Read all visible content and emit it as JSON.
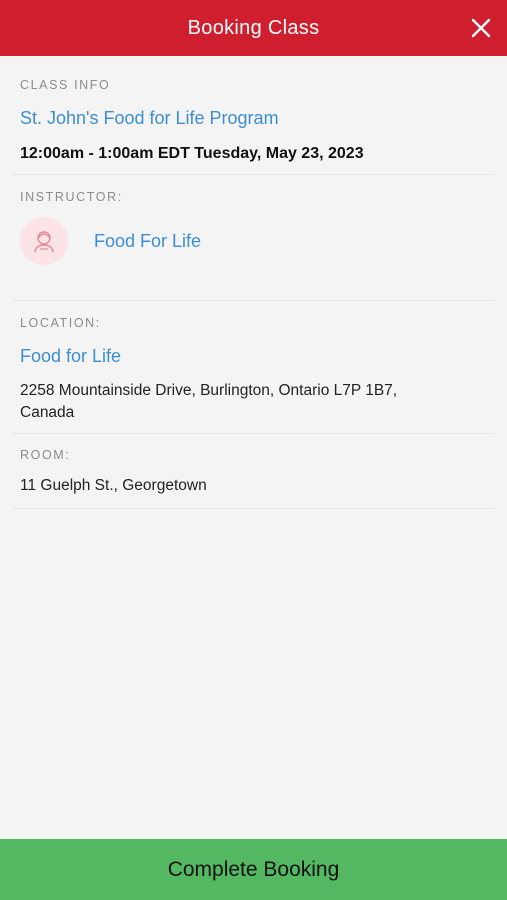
{
  "header": {
    "title": "Booking Class",
    "close_icon": "close-icon"
  },
  "class_info": {
    "label": "CLASS INFO",
    "class_name": "St. John's Food for Life Program",
    "schedule": "12:00am - 1:00am EDT Tuesday, May 23, 2023"
  },
  "instructor": {
    "label": "INSTRUCTOR:",
    "avatar_icon": "person-icon",
    "name": "Food For Life"
  },
  "location": {
    "label": "LOCATION:",
    "name": "Food for Life",
    "address": "2258 Mountainside Drive, Burlington, Ontario L7P 1B7, Canada"
  },
  "room": {
    "label": "ROOM:",
    "value": "11 Guelph St., Georgetown"
  },
  "footer": {
    "button_label": "Complete Booking"
  },
  "colors": {
    "header_bg": "#cf1f2f",
    "link": "#3b8ed3",
    "button_bg": "#54b863",
    "page_bg": "#f4f4f4"
  }
}
